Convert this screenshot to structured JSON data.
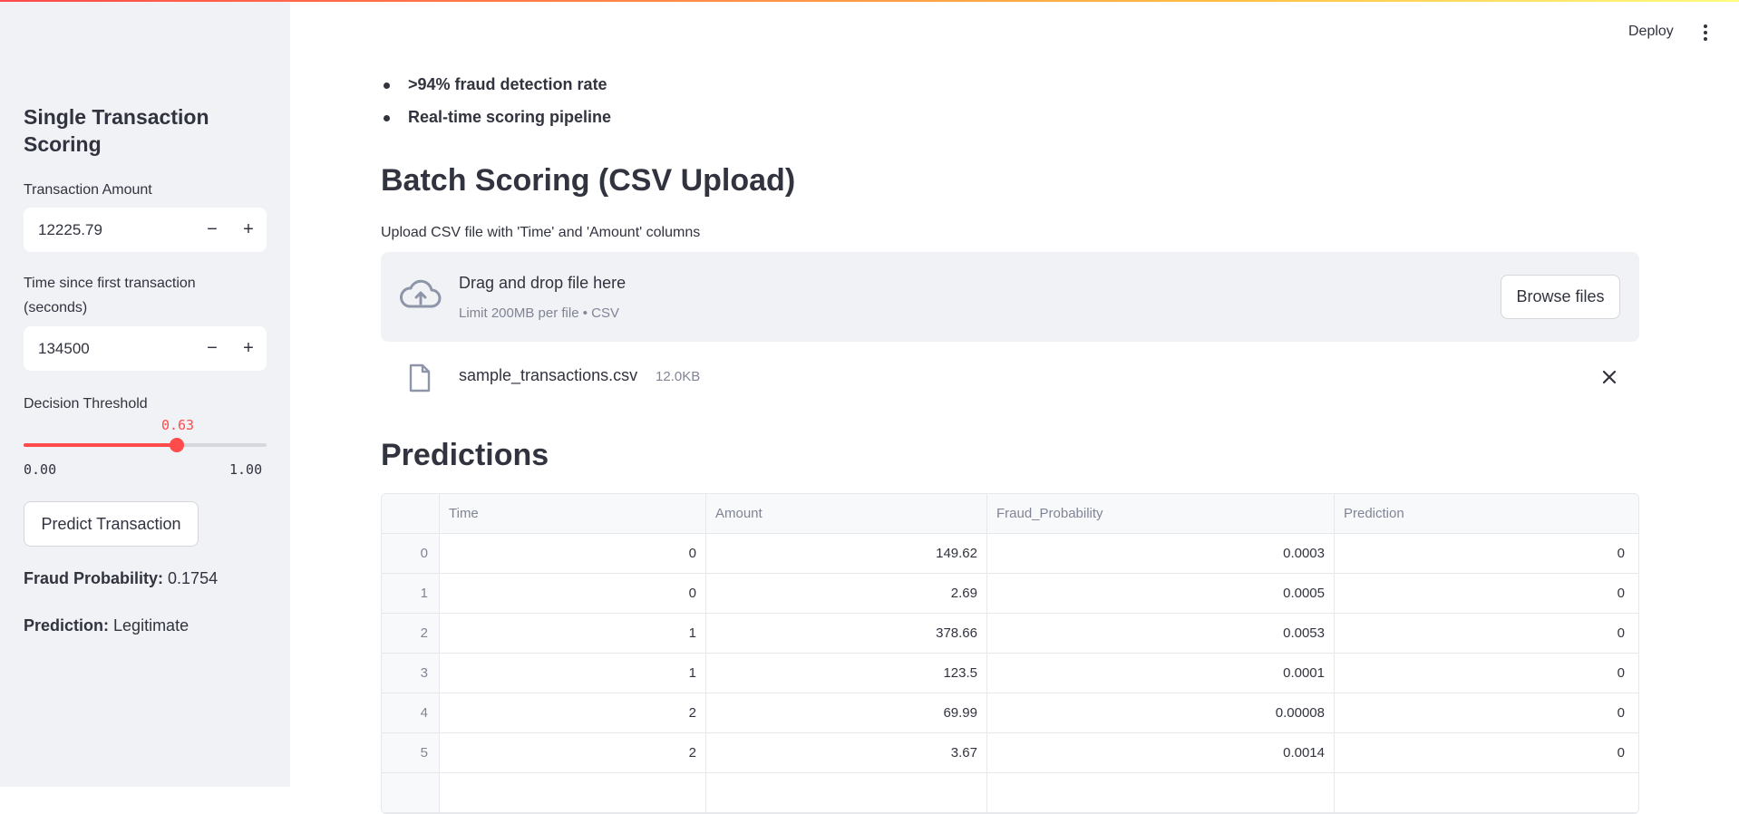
{
  "sidebar": {
    "title": "Single Transaction Scoring",
    "amount": {
      "label": "Transaction Amount",
      "value": "12225.79"
    },
    "time": {
      "label": "Time since first transaction (seconds)",
      "value": "134500"
    },
    "threshold": {
      "label": "Decision Threshold",
      "value": "0.63",
      "value_fraction": 0.63,
      "min": "0.00",
      "max": "1.00"
    },
    "stepper": {
      "minus": "−",
      "plus": "+"
    },
    "predict_label": "Predict Transaction",
    "fraud_prob_label": "Fraud Probability:",
    "fraud_prob_value": "0.1754",
    "prediction_label": "Prediction:",
    "prediction_value": "Legitimate"
  },
  "header": {
    "deploy_label": "Deploy"
  },
  "main": {
    "bullets": [
      ">94% fraud detection rate",
      "Real-time scoring pipeline"
    ],
    "batch_heading": "Batch Scoring (CSV Upload)",
    "upload_label": "Upload CSV file with 'Time' and 'Amount' columns",
    "dropzone": {
      "title": "Drag and drop file here",
      "subtitle": "Limit 200MB per file • CSV",
      "browse_label": "Browse files"
    },
    "file": {
      "name": "sample_transactions.csv",
      "size": "12.0KB"
    },
    "predictions_heading": "Predictions",
    "table": {
      "columns": [
        "Time",
        "Amount",
        "Fraud_Probability",
        "Prediction"
      ],
      "rows": [
        {
          "index": "0",
          "cells": [
            "0",
            "149.62",
            "0.0003",
            "0"
          ]
        },
        {
          "index": "1",
          "cells": [
            "0",
            "2.69",
            "0.0005",
            "0"
          ]
        },
        {
          "index": "2",
          "cells": [
            "1",
            "378.66",
            "0.0053",
            "0"
          ]
        },
        {
          "index": "3",
          "cells": [
            "1",
            "123.5",
            "0.0001",
            "0"
          ]
        },
        {
          "index": "4",
          "cells": [
            "2",
            "69.99",
            "0.00008",
            "0"
          ]
        },
        {
          "index": "5",
          "cells": [
            "2",
            "3.67",
            "0.0014",
            "0"
          ]
        }
      ]
    }
  },
  "colors": {
    "accent": "#ff4b4b",
    "sidebar_bg": "#f0f2f6",
    "text": "#31333f",
    "muted": "#808495"
  }
}
